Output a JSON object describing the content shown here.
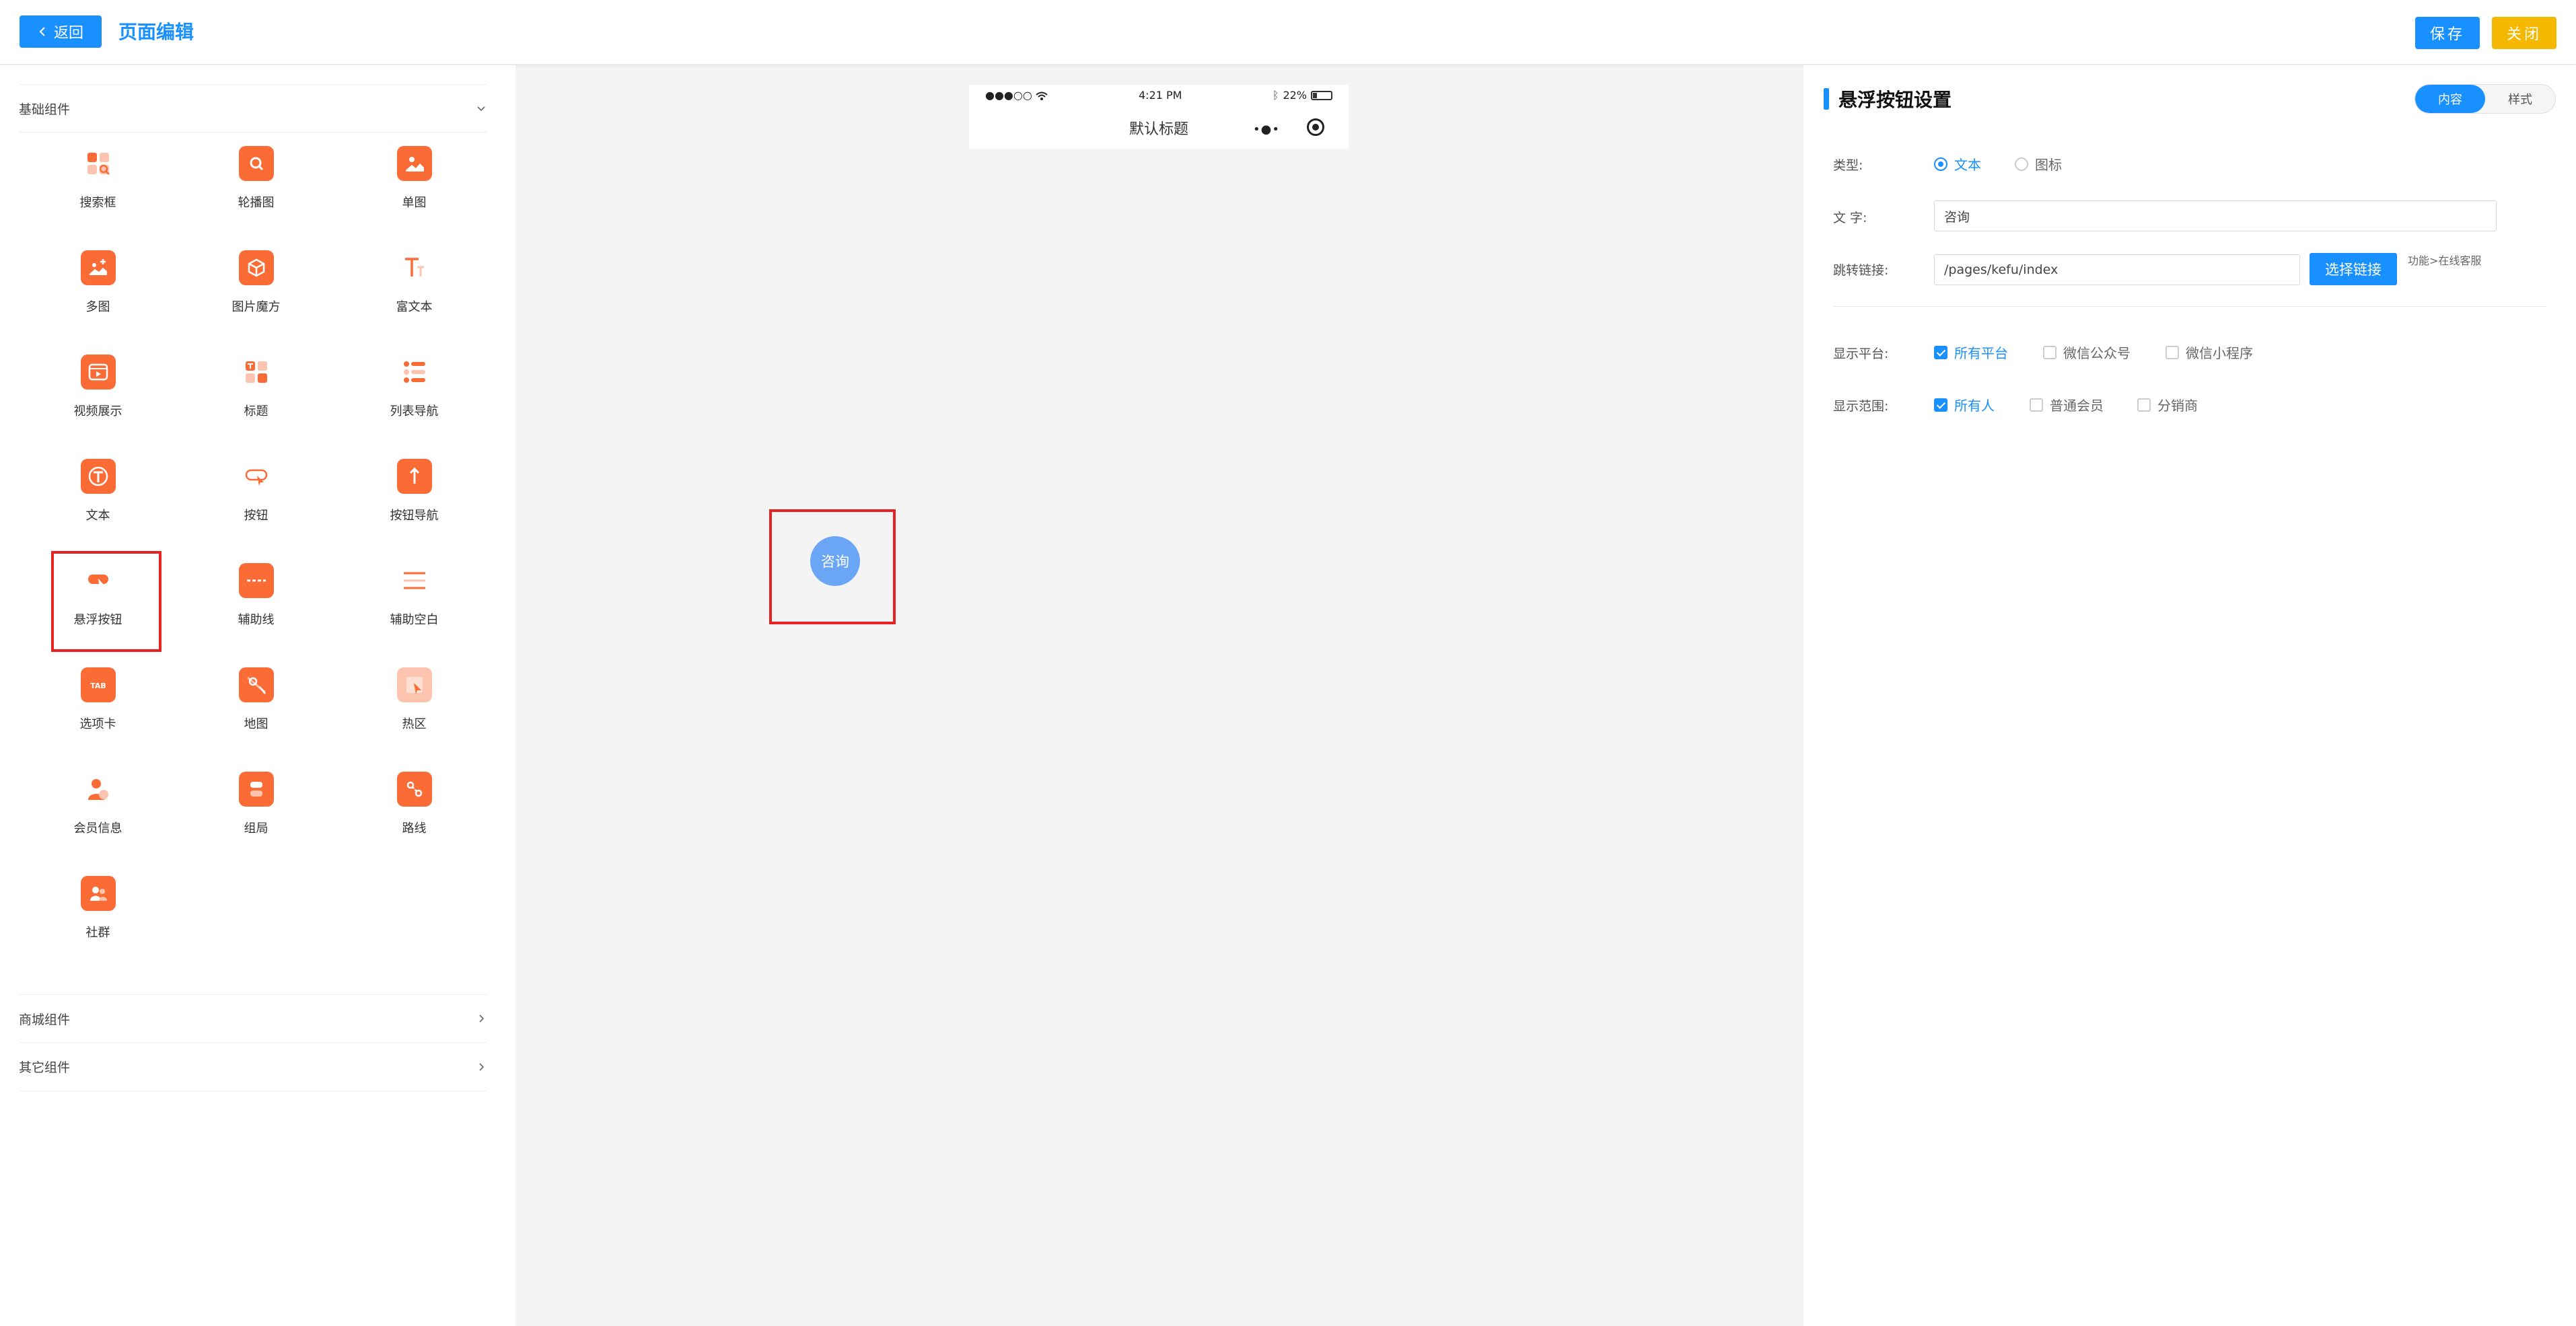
{
  "header": {
    "back_label": "返回",
    "title": "页面编辑",
    "save_label": "保存",
    "close_label": "关闭"
  },
  "left": {
    "group_basic": "基础组件",
    "group_shop": "商城组件",
    "group_other": "其它组件",
    "components": [
      {
        "label": "搜索框",
        "icon": "search-box-icon"
      },
      {
        "label": "轮播图",
        "icon": "carousel-icon"
      },
      {
        "label": "单图",
        "icon": "single-image-icon"
      },
      {
        "label": "多图",
        "icon": "multi-image-icon"
      },
      {
        "label": "图片魔方",
        "icon": "image-cube-icon"
      },
      {
        "label": "富文本",
        "icon": "rich-text-icon"
      },
      {
        "label": "视频展示",
        "icon": "video-icon"
      },
      {
        "label": "标题",
        "icon": "title-icon"
      },
      {
        "label": "列表导航",
        "icon": "list-nav-icon"
      },
      {
        "label": "文本",
        "icon": "text-icon"
      },
      {
        "label": "按钮",
        "icon": "button-icon"
      },
      {
        "label": "按钮导航",
        "icon": "button-nav-icon"
      },
      {
        "label": "悬浮按钮",
        "icon": "float-button-icon"
      },
      {
        "label": "辅助线",
        "icon": "guide-line-icon"
      },
      {
        "label": "辅助空白",
        "icon": "blank-space-icon"
      },
      {
        "label": "选项卡",
        "icon": "tab-icon"
      },
      {
        "label": "地图",
        "icon": "map-icon"
      },
      {
        "label": "热区",
        "icon": "hotspot-icon"
      },
      {
        "label": "会员信息",
        "icon": "member-icon"
      },
      {
        "label": "组局",
        "icon": "group-icon"
      },
      {
        "label": "路线",
        "icon": "route-icon"
      },
      {
        "label": "社群",
        "icon": "community-icon"
      }
    ],
    "accent": "#fa6b36"
  },
  "phone": {
    "signal": "●●●○○",
    "time": "4:21 PM",
    "battery": "22%",
    "nav_title": "默认标题",
    "nav_more": "•●•"
  },
  "float_button": {
    "label": "咨询",
    "color": "#6aa6f5"
  },
  "settings": {
    "title": "悬浮按钮设置",
    "tab_content": "内容",
    "tab_style": "样式",
    "type_label": "类型:",
    "type_text": "文本",
    "type_icon": "图标",
    "text_label": "文 字:",
    "text_value": "咨询",
    "link_label": "跳转链接:",
    "link_value": "/pages/kefu/index",
    "pick_link": "选择链接",
    "link_hint": "功能>在线客服",
    "platform_label": "显示平台:",
    "platform_all": "所有平台",
    "platform_wechat_mp": "微信公众号",
    "platform_wechat_mini": "微信小程序",
    "scope_label": "显示范围:",
    "scope_all": "所有人",
    "scope_member": "普通会员",
    "scope_distributor": "分销商"
  },
  "colors": {
    "primary": "#1890ff",
    "warning": "#f5b800",
    "highlight": "#e82222"
  }
}
